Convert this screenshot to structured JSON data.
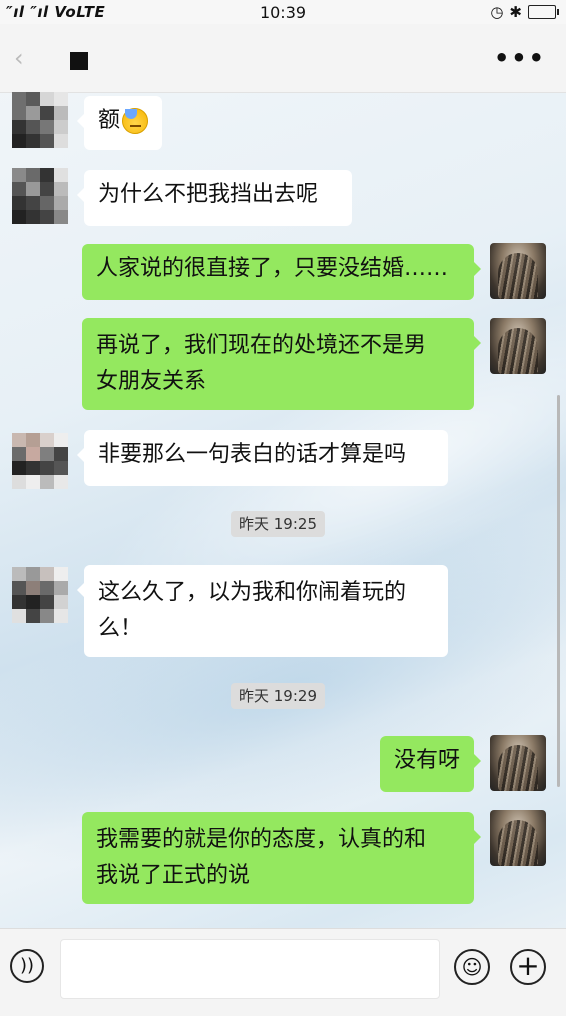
{
  "status_bar": {
    "signal": "″ıl ″ıl VoLTE",
    "time": "10:39",
    "icons": [
      "alarm-icon",
      "bluetooth-icon",
      "battery-icon"
    ]
  },
  "header": {
    "back_icon": "back-arrow-icon",
    "more_label": "•••"
  },
  "messages": [
    {
      "side": "in",
      "text": "额",
      "emoji": "sweat-smile-emoji"
    },
    {
      "side": "in",
      "text": "为什么不把我挡出去呢"
    },
    {
      "side": "out",
      "text": "人家说的很直接了，只要没结婚……"
    },
    {
      "side": "out",
      "line1": "再说了，我们现在的处境还不是男",
      "line2": "女朋友关系"
    },
    {
      "side": "in",
      "text": "非要那么一句表白的话才算是吗"
    },
    {
      "side": "in",
      "line1": "这么久了，以为我和你闹着玩的",
      "line2": "么！"
    },
    {
      "side": "out",
      "text": "没有呀"
    },
    {
      "side": "out",
      "line1": "我需要的就是你的态度，认真的和",
      "line2": "我说了正式的说"
    }
  ],
  "timestamps": [
    "昨天 19:25",
    "昨天 19:29"
  ],
  "input_bar": {
    "voice_icon": "voice-icon",
    "emoji_icon": "emoji-icon",
    "plus_icon": "plus-icon"
  },
  "colors": {
    "outgoing_bubble": "#94e85f",
    "incoming_bubble": "#ffffff",
    "header_bg": "#f4f4f4"
  }
}
